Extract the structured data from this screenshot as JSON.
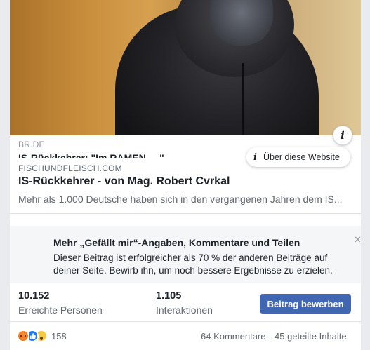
{
  "link_preview": {
    "source": "BR.DE",
    "obscured_headline": "IS-Rückkehrer: \"Im RAMEN ... \" ... ",
    "domain": "FISCHUNDFLEISCH.COM",
    "title": "IS-Rückkehrer - von Mag. Robert Cvrkal",
    "description": "Mehr als 1.000 Deutsche haben sich in den vergangenen Jahren dem IS..."
  },
  "tooltip": {
    "label": "Über diese Website",
    "icon": "info-icon"
  },
  "info_button": {
    "icon": "info-icon",
    "glyph": "i"
  },
  "promo": {
    "title": "Mehr „Gefällt mir“-Angaben, Kommentare und Teilen",
    "text": "Dieser Beitrag ist erfolgreicher als 70 % der anderen Beiträge auf deiner Seite. Bewirb ihn, um noch bessere Ergebnisse zu erzielen.",
    "close_glyph": "✕"
  },
  "stats": {
    "reach_value": "10.152",
    "reach_label": "Erreichte Personen",
    "interactions_value": "1.105",
    "interactions_label": "Interaktionen",
    "boost_label": "Beitrag bewerben"
  },
  "reactions": {
    "icons": [
      "angry-reaction-icon",
      "like-reaction-icon",
      "wow-reaction-icon"
    ],
    "count": "158",
    "comments": "64 Kommentare",
    "shares": "45 geteilte Inhalte"
  },
  "colors": {
    "accent": "#4267b2",
    "like": "#2078f4",
    "angry": "#e9710f",
    "wow": "#f7c844"
  }
}
